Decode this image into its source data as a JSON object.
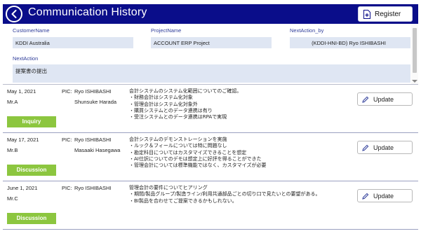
{
  "header": {
    "title": "Communication History",
    "register_label": "Register"
  },
  "form": {
    "customer_label": "CustomerName",
    "customer_value": "KDDI Australia",
    "project_label": "ProjectName",
    "project_value": "ACCOUNT ERP Project",
    "next_by_label": "NextAction_by",
    "next_by_value": "(KDDI-HNI-BD) Ryo ISHIBASHI",
    "next_action_label": "NextAction",
    "next_action_value": "提案書の提出"
  },
  "history": [
    {
      "date": "May 1, 2021",
      "contact": "Mr.A",
      "pic_label": "PIC:",
      "pic1": "Ryo ISHIBASHI",
      "pic2": "Shunsuke Harada",
      "notes": [
        "会計システムのシステム化範囲についてのご確認。",
        "・財務会計はシステム化対象",
        "・管理会計はシステム化対象外",
        "・購買システムとのデータ連携は有り",
        "・受注システムとのデータ連携はRPAで実現"
      ],
      "category": "Inquiry",
      "update_label": "Update"
    },
    {
      "date": "May 17, 2021",
      "contact": "Mr.B",
      "pic_label": "PIC:",
      "pic1": "Ryo ISHIBASHI",
      "pic2": "Masaaki Hasegawa",
      "notes": [
        "会計システムのデモンストレーションを実施",
        "・ルック＆フィールについては特に問題なし",
        "・勘定科目についてはカスタマイズできることを想定",
        "・AI仕訳についてのデモは想定上に好評を得ることができた",
        "・管理会計については標準機能ではなく、カスタマイズが必要"
      ],
      "category": "Discussion",
      "update_label": "Update"
    },
    {
      "date": "June 1, 2021",
      "contact": "Mr.C",
      "pic_label": "PIC:",
      "pic1": "Ryo ISHIBASHI",
      "pic2": "",
      "notes": [
        "管理会計の要件についてヒアリング",
        "・期間/製品グループ/製造ライン/利用共通部品ごとの切り口で見たいとの要望がある。",
        "・BI製品を合わせてご提案できるかもしれない。"
      ],
      "category": "Discussion",
      "update_label": "Update"
    }
  ],
  "colors": {
    "header_bg": "#0a0d8a",
    "field_bg": "#dfe6f3",
    "label_color": "#2f3d9a",
    "badge_green": "#8cc63f"
  }
}
